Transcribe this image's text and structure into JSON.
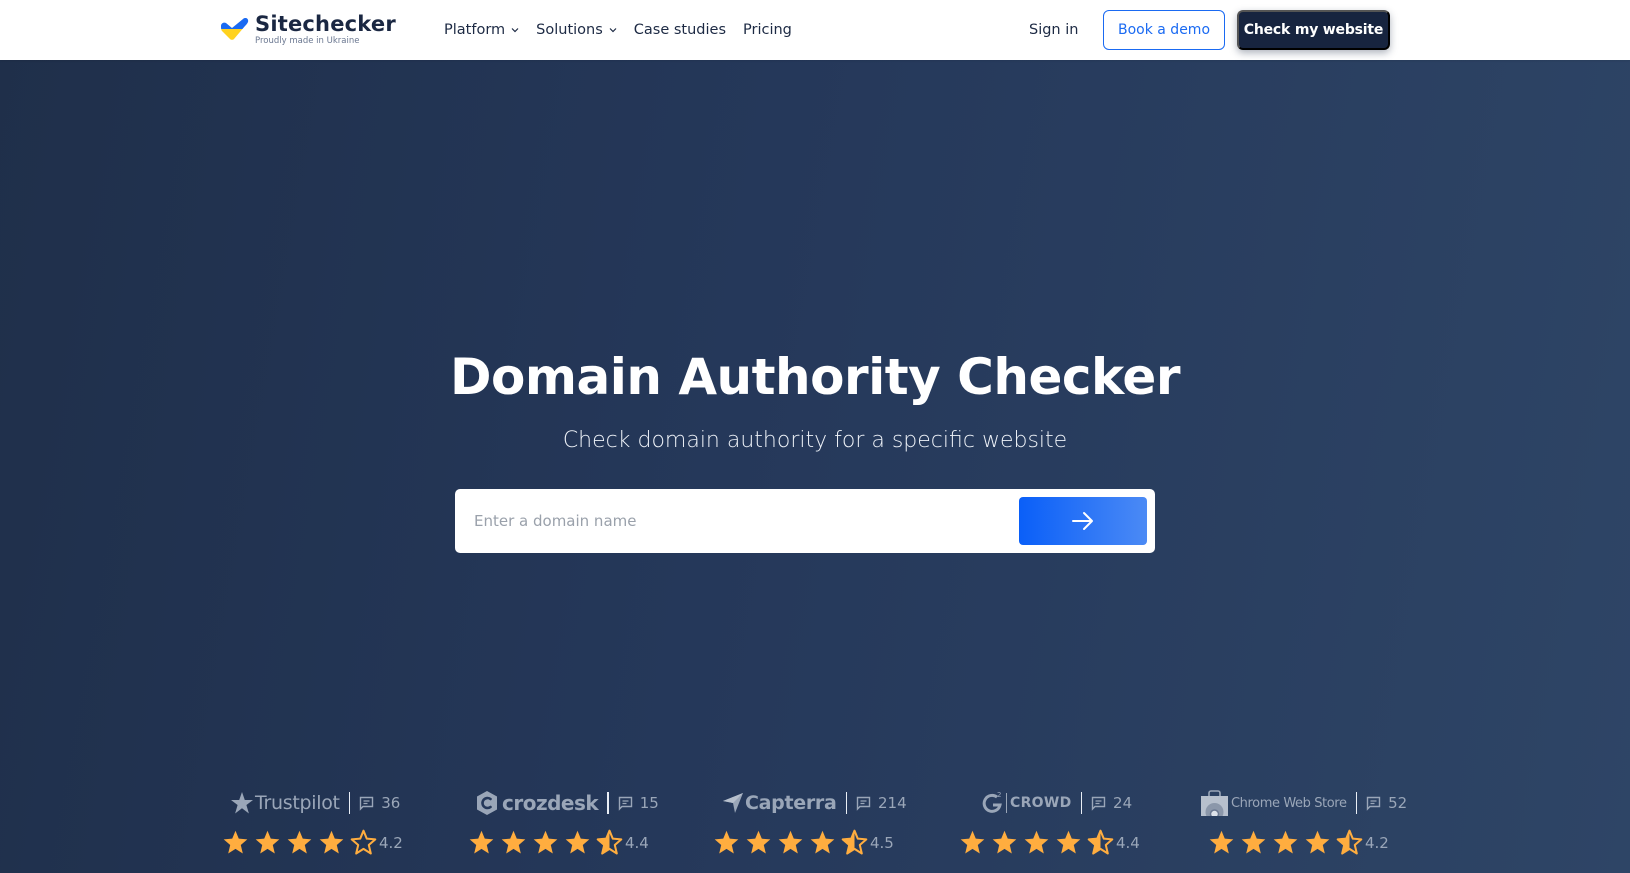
{
  "header": {
    "logo": {
      "name": "Sitechecker",
      "tagline": "Proudly made in Ukraine",
      "colors": {
        "top": "#1a6af2",
        "bottom": "#ffd21f"
      }
    },
    "nav": [
      {
        "label": "Platform",
        "has_dropdown": true
      },
      {
        "label": "Solutions",
        "has_dropdown": true
      },
      {
        "label": "Case studies",
        "has_dropdown": false
      },
      {
        "label": "Pricing",
        "has_dropdown": false
      }
    ],
    "sign_in": "Sign in",
    "book_demo": "Book a demo",
    "check_website": "Check my website"
  },
  "hero": {
    "title": "Domain Authority Checker",
    "subtitle": "Check domain authority for a specific website",
    "search": {
      "placeholder": "Enter a domain name",
      "value": "",
      "submit_icon": "arrow-right-icon"
    }
  },
  "reviews": [
    {
      "platform": "Trustpilot",
      "icon": "trustpilot-star-icon",
      "count": "36",
      "rating": "4.2",
      "stars": [
        1,
        1,
        1,
        1,
        0
      ]
    },
    {
      "platform": "crozdesk",
      "icon": "crozdesk-logo-icon",
      "count": "15",
      "rating": "4.4",
      "stars": [
        1,
        1,
        1,
        1,
        0.5
      ]
    },
    {
      "platform": "Capterra",
      "icon": "capterra-logo-icon",
      "count": "214",
      "rating": "4.5",
      "stars": [
        1,
        1,
        1,
        1,
        0.5
      ]
    },
    {
      "platform": "CROWD",
      "icon": "g2-logo-icon",
      "count": "24",
      "rating": "4.4",
      "stars": [
        1,
        1,
        1,
        1,
        0.5
      ]
    },
    {
      "platform": "Chrome Web Store",
      "icon": "chrome-web-store-icon",
      "count": "52",
      "rating": "4.2",
      "stars": [
        1,
        1,
        1,
        1,
        0.5
      ]
    }
  ],
  "colors": {
    "accent": "#1a6af2",
    "dark": "#17243f",
    "star": "#ffad3f",
    "muted_text": "#9aa6b8"
  }
}
